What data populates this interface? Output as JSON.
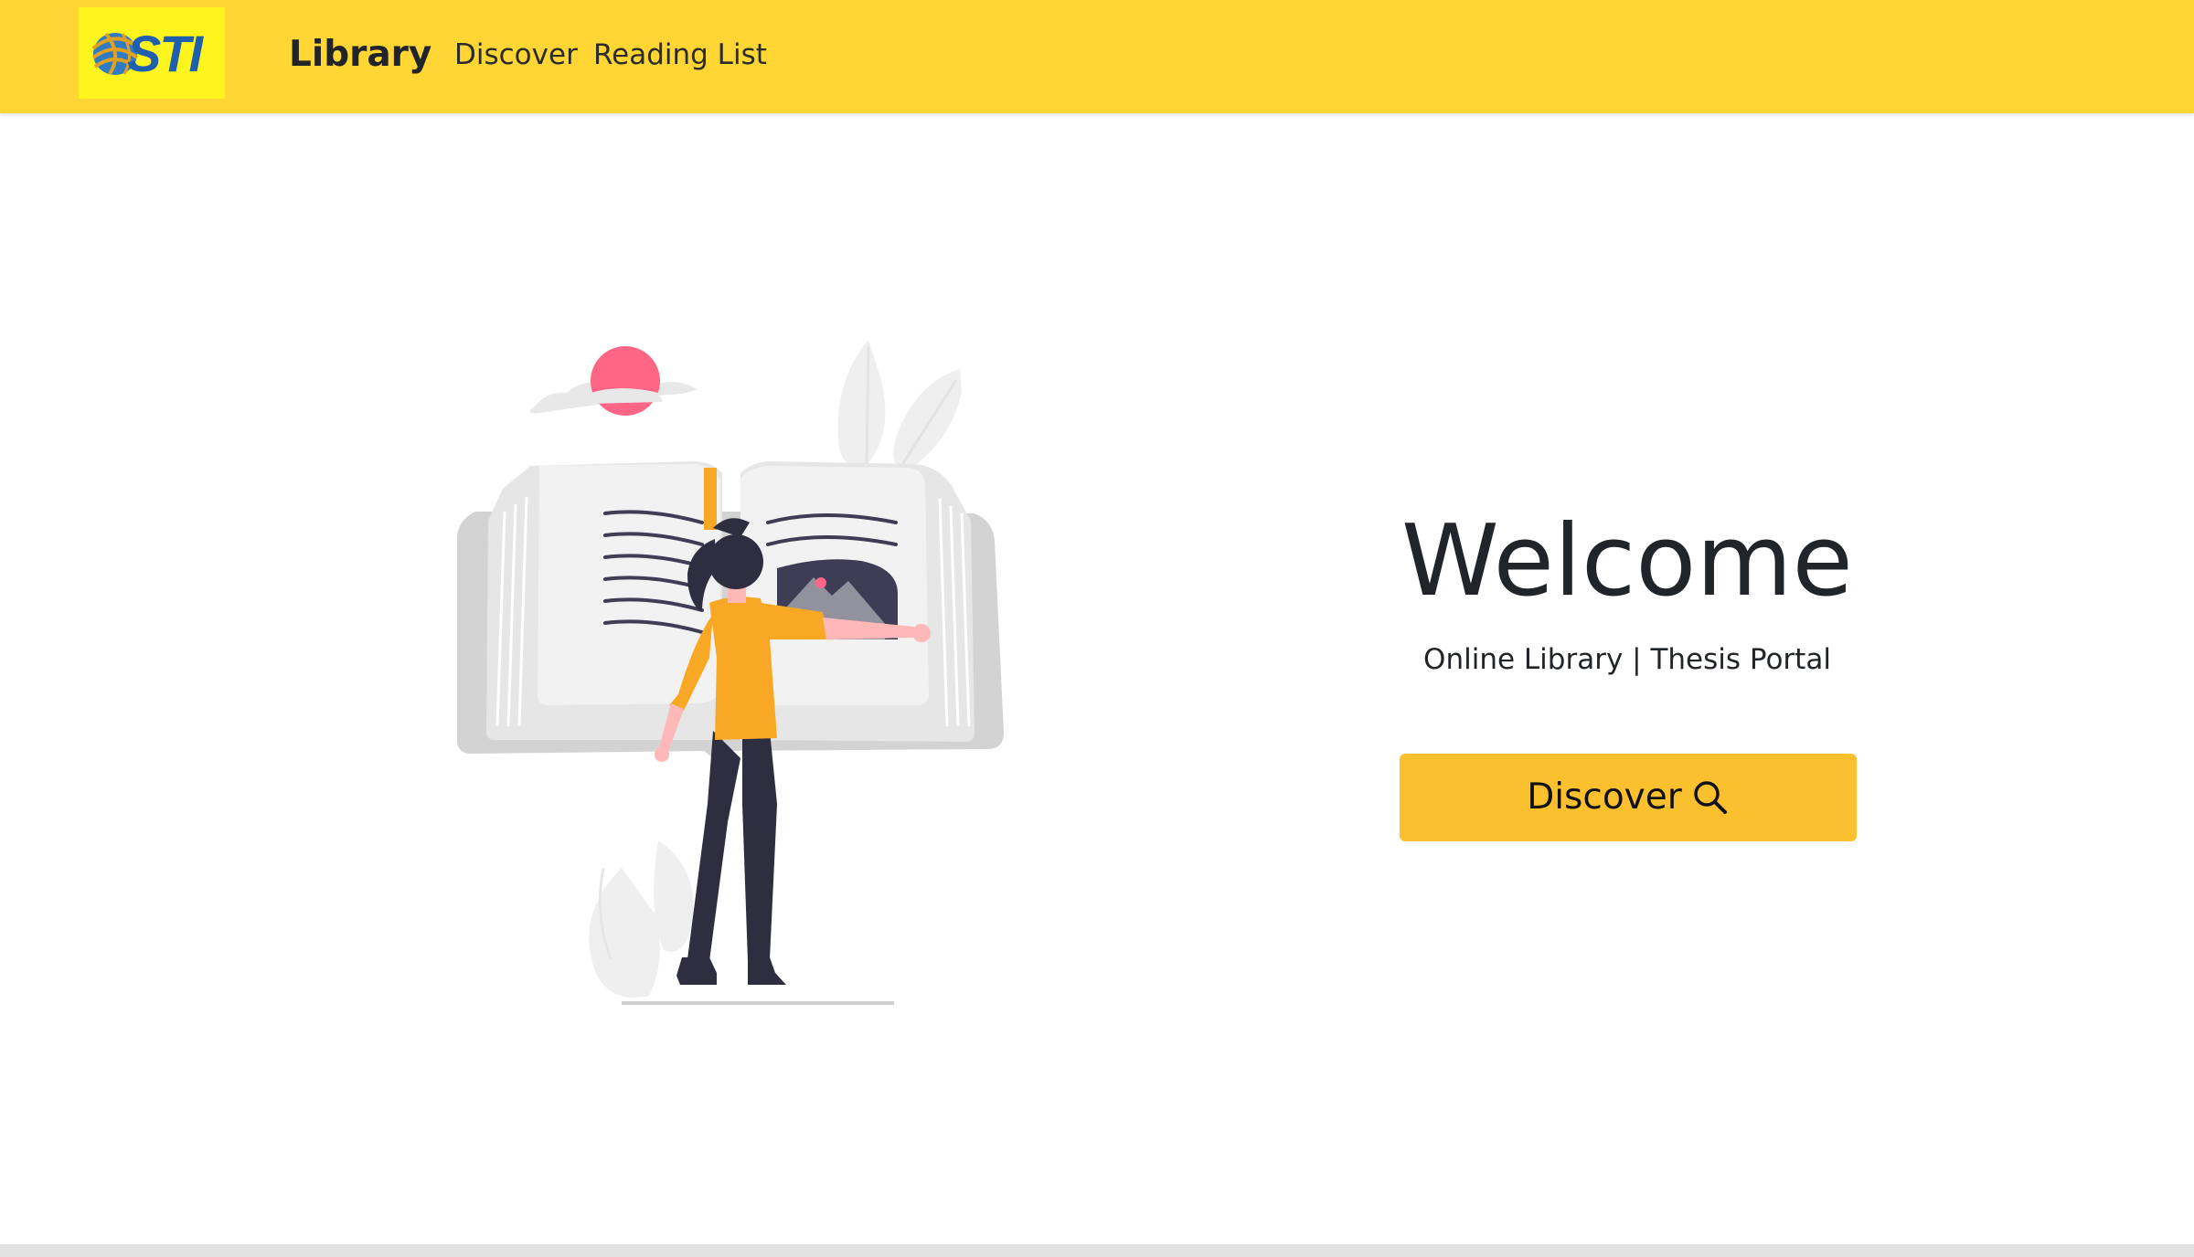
{
  "navbar": {
    "logo_text": "STI",
    "brand": "Library",
    "links": [
      {
        "label": "Discover"
      },
      {
        "label": "Reading List"
      }
    ],
    "background": "#FFD633"
  },
  "hero": {
    "title": "Welcome",
    "subtitle": "Online Library | Thesis Portal",
    "cta_label": "Discover",
    "cta_icon": "search-icon",
    "cta_color": "#FBC02D"
  },
  "illustration": {
    "icon": "woman-reading-book-illustration",
    "accent": "#F9A826",
    "sun_color": "#FF6584"
  }
}
